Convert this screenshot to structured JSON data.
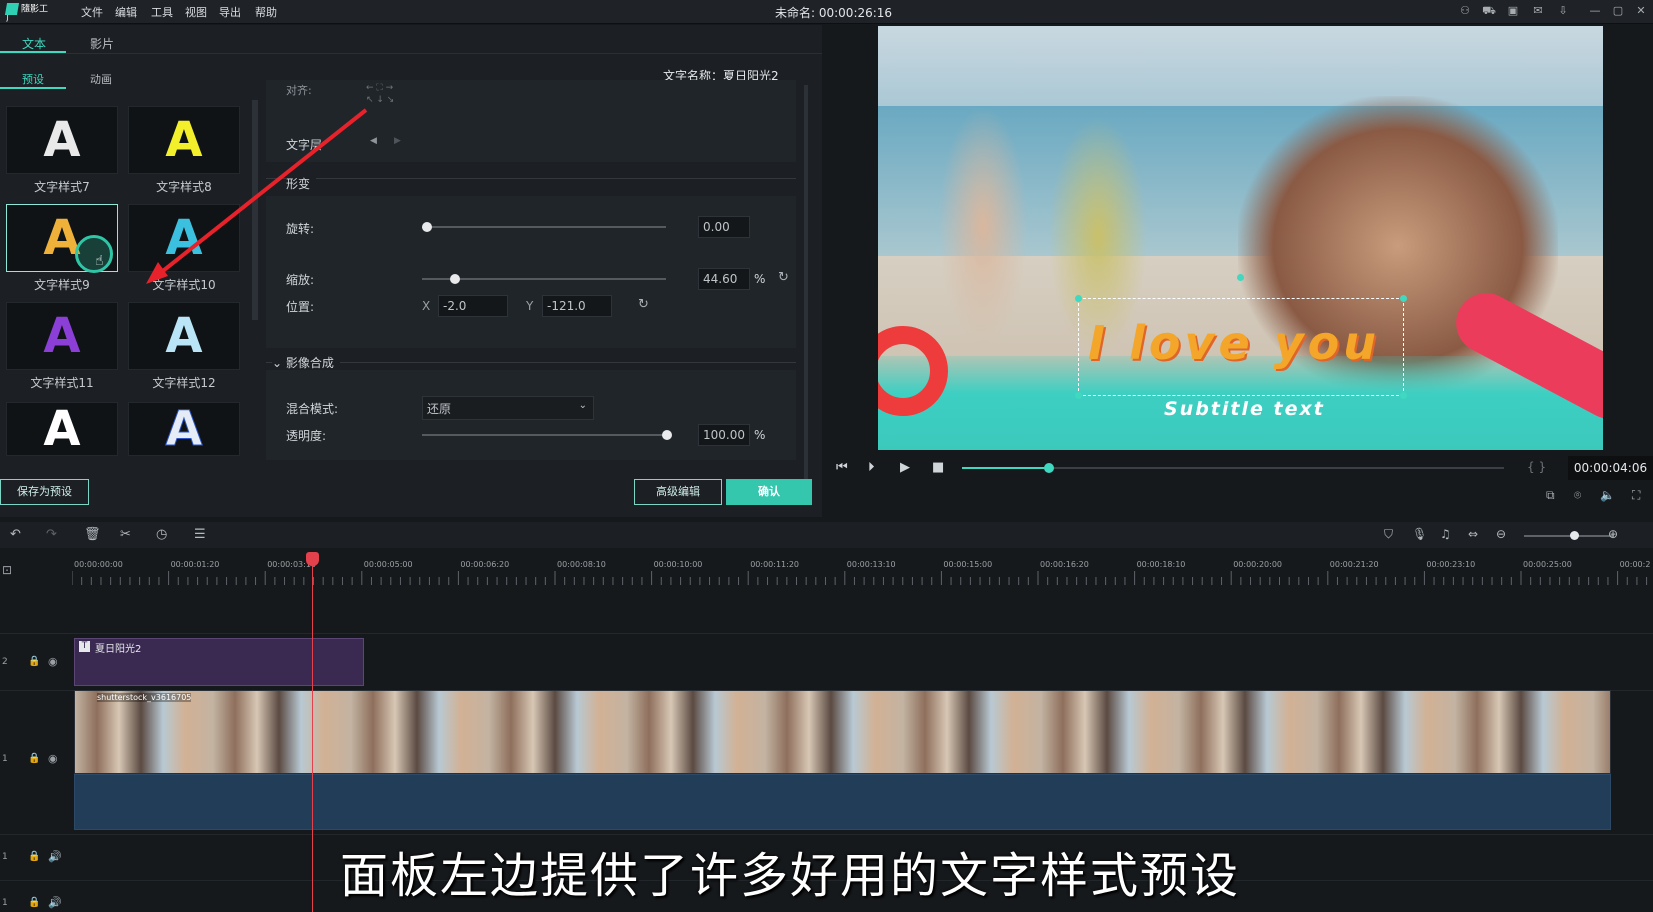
{
  "app": {
    "logo_text": "隨影工厂",
    "menu": [
      "文件",
      "编辑",
      "工具",
      "视图",
      "导出",
      "帮助"
    ],
    "doc_title": "未命名: 00:00:26:16"
  },
  "left_tabs": {
    "text": "文本",
    "movie": "影片"
  },
  "sub_tabs": {
    "preset": "预设",
    "animation": "动画"
  },
  "text_name": "文字名称：夏日阳光2",
  "presets": [
    {
      "label": "文字样式7",
      "color": "#e9e9e9"
    },
    {
      "label": "文字样式8",
      "color": "#f4ef2b"
    },
    {
      "label": "文字样式9",
      "color": "#f0b13a"
    },
    {
      "label": "文字样式10",
      "color": "#3cc0e0"
    },
    {
      "label": "文字样式11",
      "color": "#8b3fd6"
    },
    {
      "label": "文字样式12",
      "color": "#b9e5f6"
    },
    {
      "label": "",
      "color": "#ffffff"
    },
    {
      "label": "",
      "color": "#e6ecf5"
    }
  ],
  "props": {
    "align_label": "对齐:",
    "text_direction_label": "文字层",
    "transform_header": "形变",
    "rotation_label": "旋转:",
    "rotation_value": "0.00",
    "scale_label": "缩放:",
    "scale_value": "44.60",
    "scale_unit": "%",
    "position_label": "位置:",
    "x_label": "X",
    "x_value": "-2.0",
    "y_label": "Y",
    "y_value": "-121.0",
    "compositing_header": "影像合成",
    "blend_label": "混合模式:",
    "blend_value": "还原",
    "opacity_label": "透明度:",
    "opacity_value": "100.00",
    "opacity_unit": "%"
  },
  "buttons": {
    "save_preset": "保存为预设",
    "advanced_edit": "高级编辑",
    "confirm": "确认"
  },
  "preview": {
    "title_text": "I love you",
    "subtitle_text": "Subtitle text",
    "timecode": "00:00:04:06",
    "playback_fraction": 0.16
  },
  "timeline": {
    "ruler": [
      "00:00:00:00",
      "00:00:01:20",
      "00:00:03:10",
      "00:00:05:00",
      "00:00:06:20",
      "00:00:08:10",
      "00:00:10:00",
      "00:00:11:20",
      "00:00:13:10",
      "00:00:15:00",
      "00:00:16:20",
      "00:00:18:10",
      "00:00:20:00",
      "00:00:21:20",
      "00:00:23:10",
      "00:00:25:00",
      "00:00:2"
    ],
    "text_clip_label": "夏日阳光2",
    "video_clip_label": "shutterstock_v3616705",
    "track_numbers": [
      "2",
      "1",
      "1",
      "1"
    ]
  },
  "caption": "面板左边提供了许多好用的文字样式预设",
  "colors": {
    "accent": "#34c7ad",
    "playhead": "#e3414b",
    "annotation_arrow": "#e8222b"
  }
}
